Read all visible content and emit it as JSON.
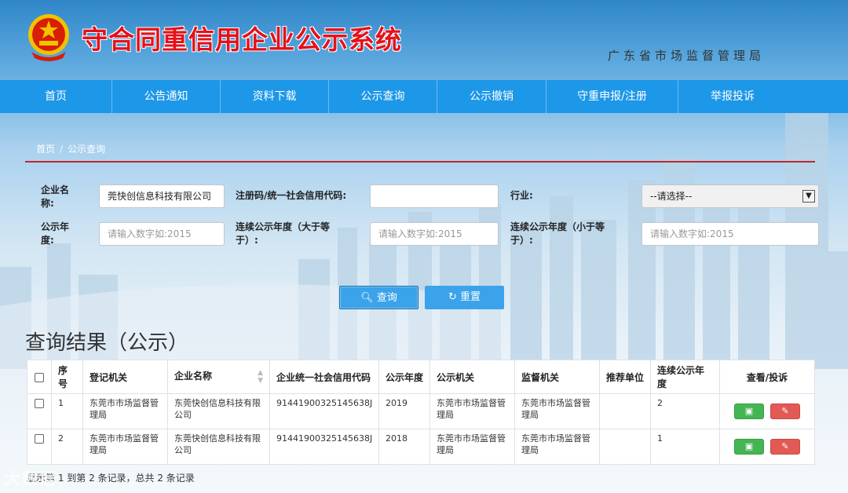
{
  "header": {
    "title": "守合同重信用企业公示系统",
    "subtitle": "广东省市场监督管理局"
  },
  "nav": {
    "items": [
      "首页",
      "公告通知",
      "资料下载",
      "公示查询",
      "公示撤销",
      "守重申报/注册",
      "举报投诉"
    ]
  },
  "breadcrumb": {
    "home": "首页",
    "sep": "/",
    "current": "公示查询"
  },
  "form": {
    "company_name_label": "企业名称:",
    "company_name_value": "莞快创信息科技有限公司",
    "credit_code_label": "注册码/统一社会信用代码:",
    "credit_code_value": "",
    "industry_label": "行业:",
    "industry_selected": "--请选择--",
    "year_label": "公示年度:",
    "year_placeholder": "请输入数字如:2015",
    "cont_gt_label": "连续公示年度（大于等于）:",
    "cont_gt_placeholder": "请输入数字如:2015",
    "cont_lt_label": "连续公示年度（小于等于）:",
    "cont_lt_placeholder": "请输入数字如:2015",
    "query_button": "查询",
    "reset_button": "重置"
  },
  "results": {
    "title": "查询结果（公示）",
    "columns": [
      "序号",
      "登记机关",
      "企业名称",
      "企业统一社会信用代码",
      "公示年度",
      "公示机关",
      "监督机关",
      "推荐单位",
      "连续公示年度",
      "查看/投诉"
    ],
    "rows": [
      {
        "index": "1",
        "reg_authority": "东莞市市场监督管理局",
        "company": "东莞快创信息科技有限公司",
        "credit_code": "91441900325145638J",
        "year": "2019",
        "pub_authority": "东莞市市场监督管理局",
        "sup_authority": "东莞市市场监督管理局",
        "recommender": "",
        "cont_year": "2"
      },
      {
        "index": "2",
        "reg_authority": "东莞市市场监督管理局",
        "company": "东莞快创信息科技有限公司",
        "credit_code": "91441900325145638J",
        "year": "2018",
        "pub_authority": "东莞市市场监督管理局",
        "sup_authority": "东莞市市场监督管理局",
        "recommender": "",
        "cont_year": "1"
      }
    ],
    "summary": "显示第 1 到第 2 条记录，总共 2 条记录"
  },
  "watermark": "大数据",
  "colors": {
    "nav": "#1d97e8",
    "title": "#e4111a",
    "divider": "#c0262c",
    "view_button": "#44b553",
    "complain_button": "#e15a55"
  },
  "icons": {
    "query": "search-icon",
    "reset": "refresh-icon",
    "view": "document-icon",
    "complain": "edit-icon",
    "select": "chevron-down-icon",
    "sort": "sort-icon"
  }
}
